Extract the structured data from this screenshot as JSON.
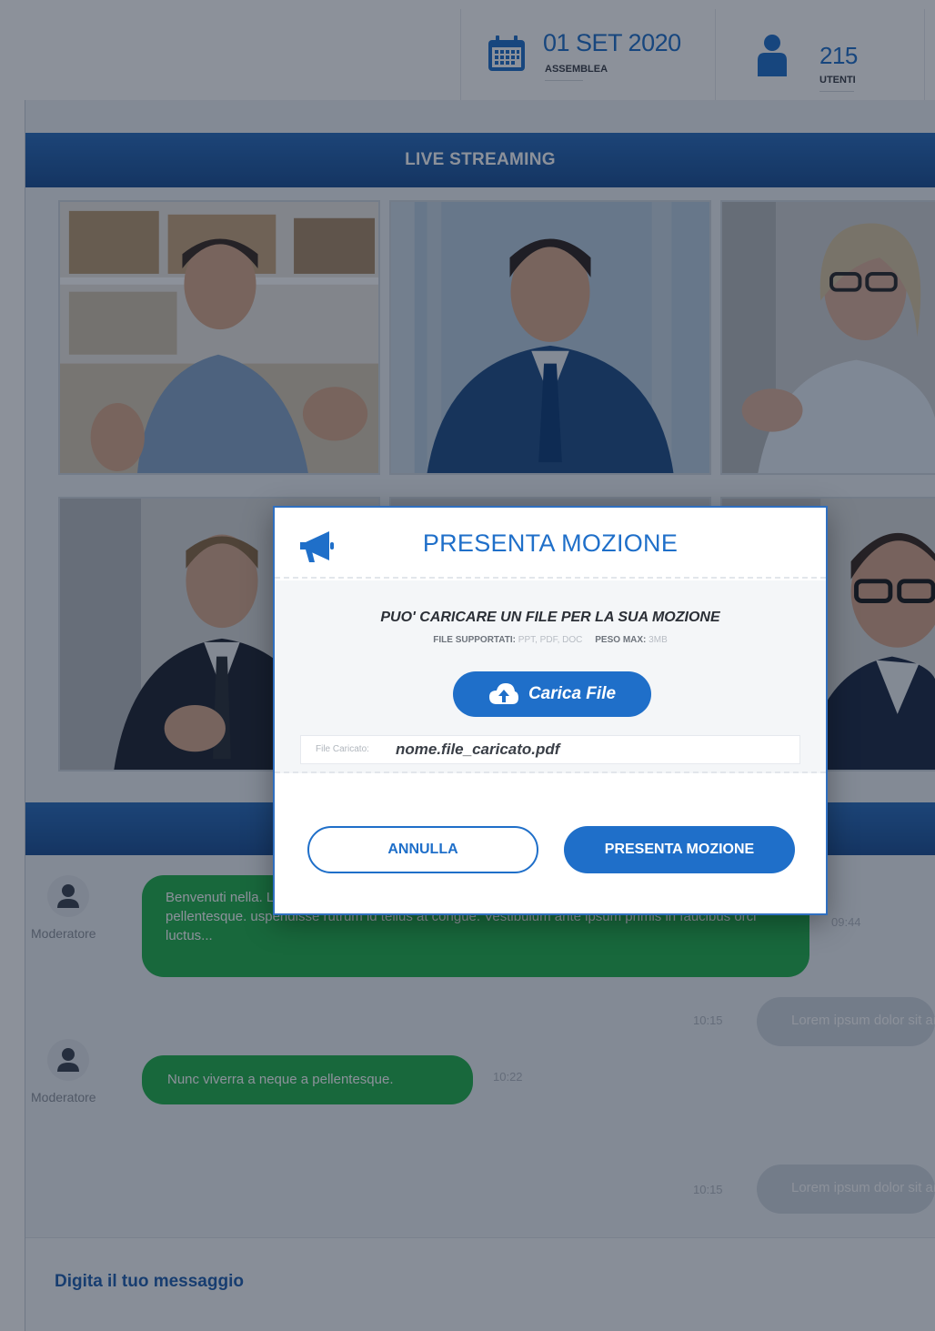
{
  "header": {
    "date_value": "01 SET 2020",
    "date_label": "ASSEMBLEA",
    "users_value": "215",
    "users_label": "UTENTI"
  },
  "live": {
    "title": "LIVE STREAMING",
    "participants": 6
  },
  "chat": {
    "messages": [
      {
        "author": "Moderatore",
        "text": "Benvenuti nella. Lorem ipsum dolor sit amet, consectetur adipiscing elit. Nunc viverra a neque a pellentesque. uspendisse rutrum id tellus at congue. Vestibulum ante ipsum primis in faucibus orci luctus...",
        "time": "09:44"
      },
      {
        "author": "",
        "text": "Lorem ipsum dolor sit amet",
        "time": "10:15"
      },
      {
        "author": "Moderatore",
        "text": "Nunc viverra a neque a pellentesque.",
        "time": "10:22"
      },
      {
        "author": "",
        "text": "Lorem ipsum dolor sit amet",
        "time": "10:15"
      }
    ],
    "composer_placeholder": "Digita il tuo messaggio"
  },
  "modal": {
    "title": "PRESENTA MOZIONE",
    "upload_heading": "PUO' CARICARE UN FILE PER LA SUA MOZIONE",
    "supported_label": "FILE SUPPORTATI:",
    "supported_value": "PPT, PDF, DOC",
    "maxsize_label": "PESO MAX:",
    "maxsize_value": "3MB",
    "upload_button": "Carica File",
    "file_label": "File Caricato:",
    "file_name": "nome.file_caricato.pdf",
    "cancel_button": "ANNULLA",
    "submit_button": "PRESENTA MOZIONE"
  },
  "colors": {
    "brand_blue": "#1f6fc9",
    "header_blue": "#1b4f94",
    "incoming_bubble": "#22b14c",
    "outgoing_bubble": "#cfd6de",
    "overlay": "rgba(14,26,44,0.48)"
  },
  "icons": {
    "date": "calendar-icon",
    "users": "user-icon",
    "modal": "megaphone-icon",
    "upload": "cloud-upload-icon",
    "avatar": "user-avatar-icon"
  }
}
